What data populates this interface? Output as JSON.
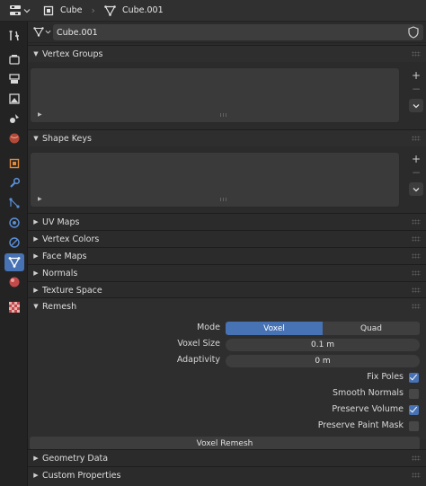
{
  "header": {
    "object_name": "Cube",
    "mesh_name": "Cube.001"
  },
  "datablock": {
    "name": "Cube.001"
  },
  "panels": {
    "vertex_groups": "Vertex Groups",
    "shape_keys": "Shape Keys",
    "uv_maps": "UV Maps",
    "vertex_colors": "Vertex Colors",
    "face_maps": "Face Maps",
    "normals": "Normals",
    "texture_space": "Texture Space",
    "remesh": "Remesh",
    "geometry_data": "Geometry Data",
    "custom_properties": "Custom Properties"
  },
  "remesh": {
    "mode_label": "Mode",
    "mode_options": [
      "Voxel",
      "Quad"
    ],
    "mode_selected": "Voxel",
    "voxel_size_label": "Voxel Size",
    "voxel_size_value": "0.1 m",
    "adaptivity_label": "Adaptivity",
    "adaptivity_value": "0 m",
    "checks": [
      {
        "label": "Fix Poles",
        "checked": true
      },
      {
        "label": "Smooth Normals",
        "checked": false
      },
      {
        "label": "Preserve Volume",
        "checked": true
      },
      {
        "label": "Preserve Paint Mask",
        "checked": false
      }
    ],
    "button": "Voxel Remesh"
  },
  "colors": {
    "accent": "#4772b3",
    "panel": "#2e2e2e",
    "field": "#3d3d3d"
  }
}
